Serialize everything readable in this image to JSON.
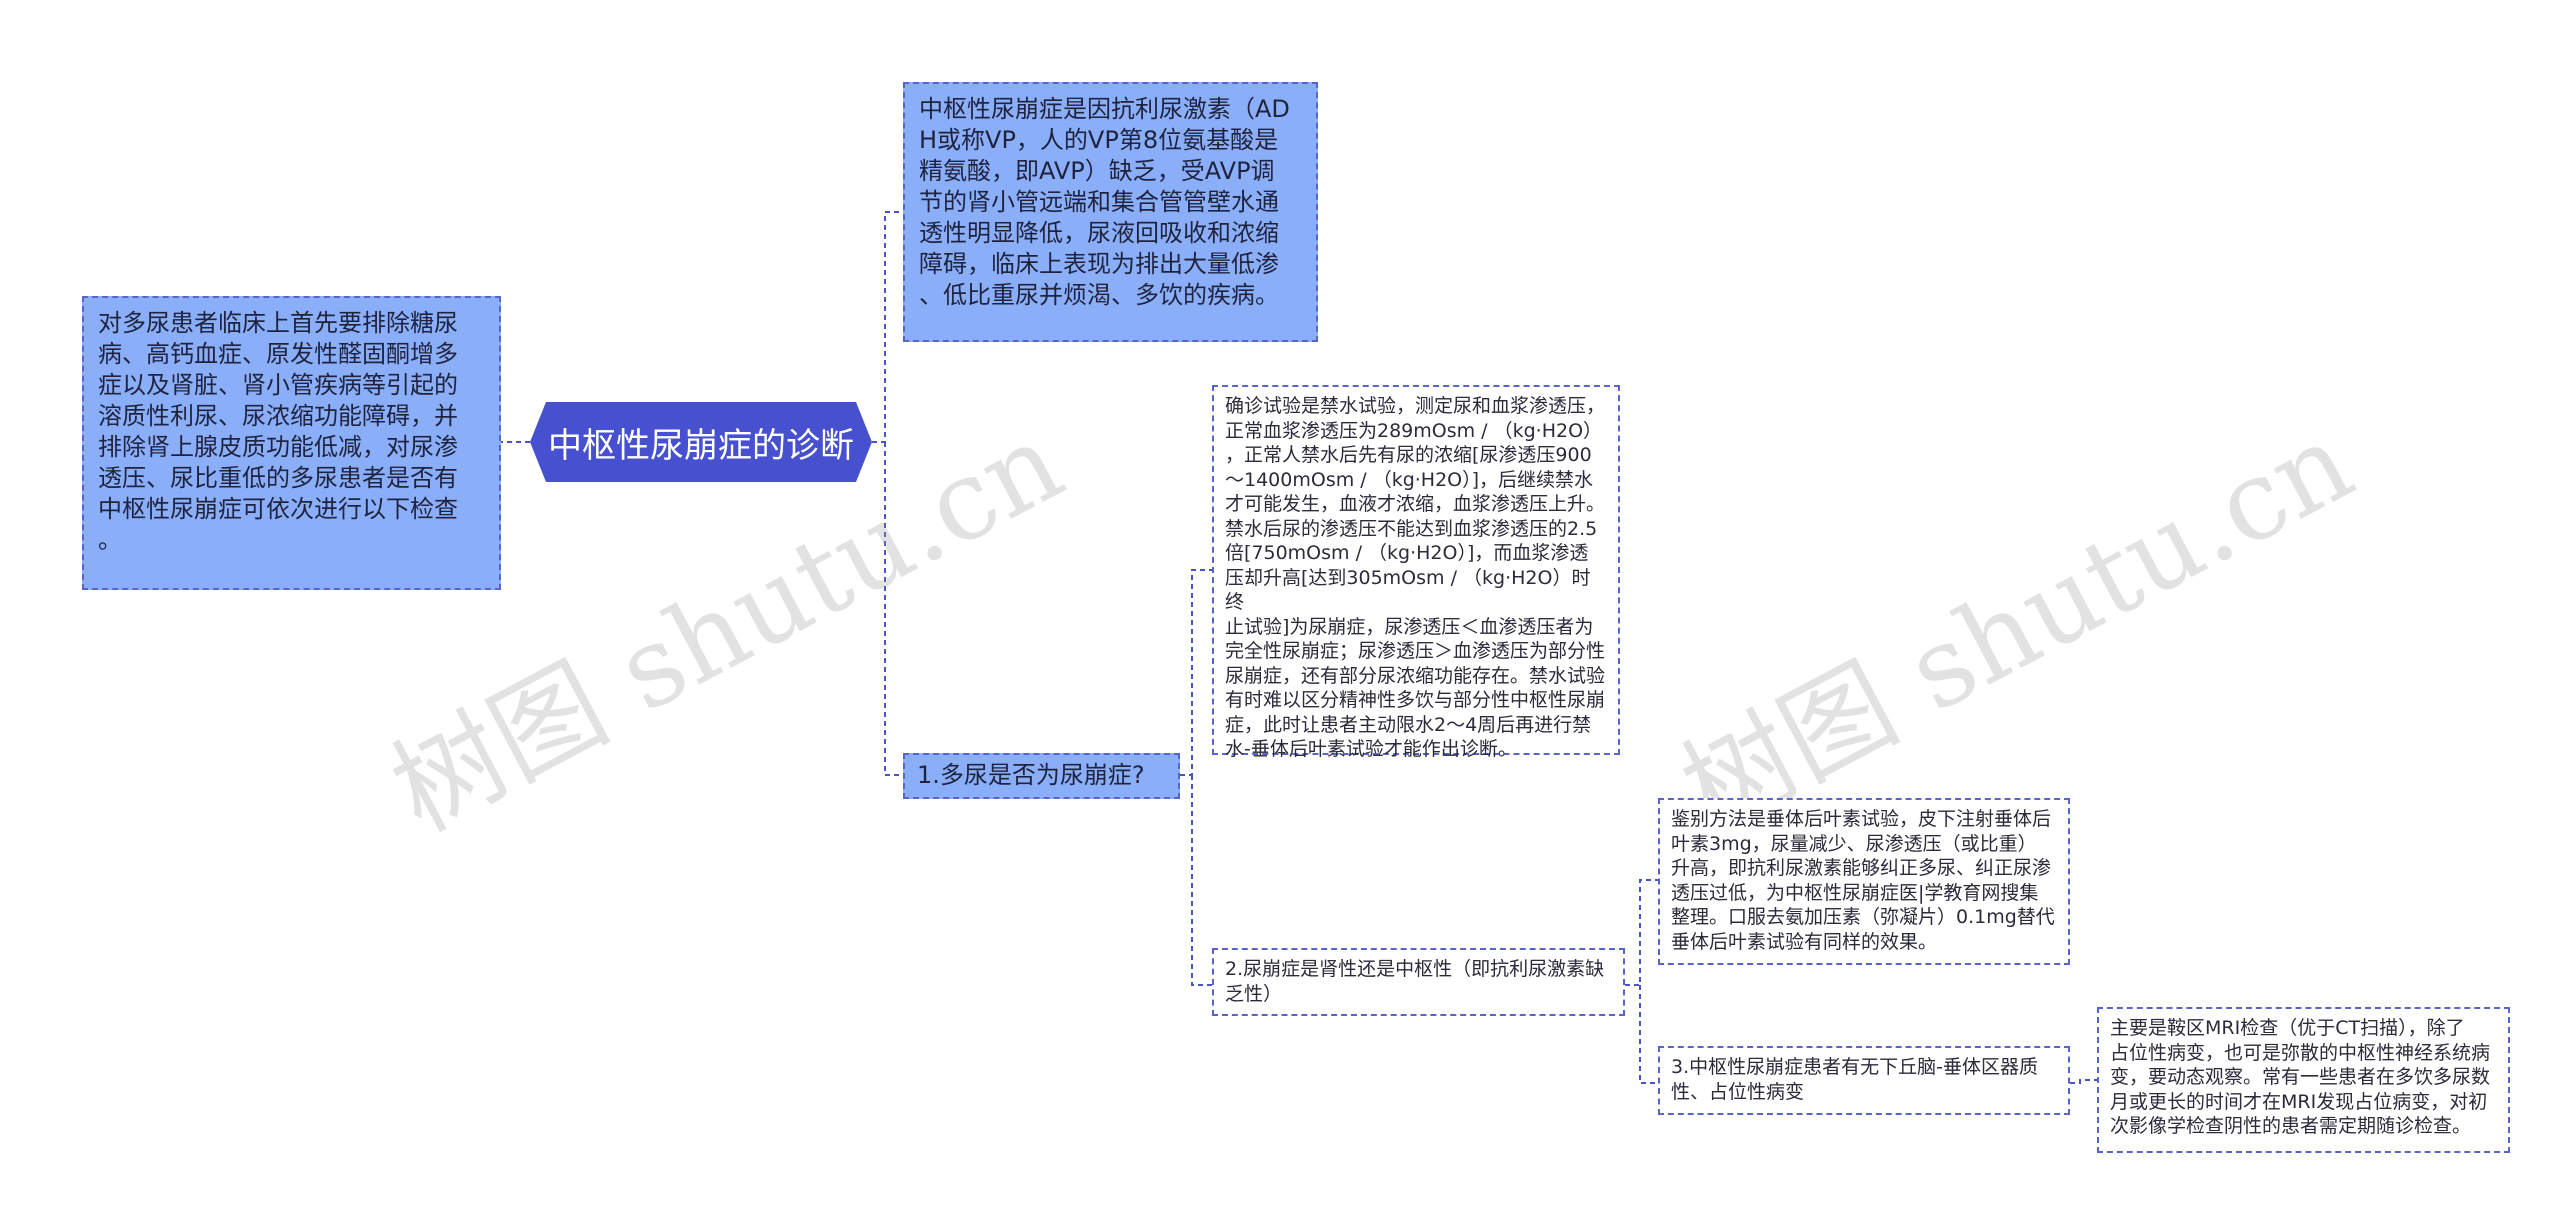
{
  "diagram": {
    "root": {
      "label": "中枢性尿崩症的诊断"
    },
    "left_note": {
      "text": "对多尿患者临床上首先要排除糖尿\n病、高钙血症、原发性醛固酮增多\n症以及肾脏、肾小管疾病等引起的\n溶质性利尿、尿浓缩功能障碍，并\n排除肾上腺皮质功能低减，对尿渗\n透压、尿比重低的多尿患者是否有\n中枢性尿崩症可依次进行以下检查\n。"
    },
    "definition": {
      "text": "中枢性尿崩症是因抗利尿激素（AD\nH或称VP，人的VP第8位氨基酸是\n精氨酸，即AVP）缺乏，受AVP调\n节的肾小管远端和集合管管壁水通\n透性明显降低，尿液回吸收和浓缩\n障碍，临床上表现为排出大量低渗\n、低比重尿并烦渴、多饮的疾病。"
    },
    "step1": {
      "label": "1.多尿是否为尿崩症?"
    },
    "step1_detail": {
      "text": "确诊试验是禁水试验，测定尿和血浆渗透压，\n正常血浆渗透压为289mOsm /  （kg·H2O）\n，正常人禁水后先有尿的浓缩[尿渗透压900\n～1400mOsm /  （kg·H2O）]，后继续禁水\n才可能发生，血液才浓缩，血浆渗透压上升。\n禁水后尿的渗透压不能达到血浆渗透压的2.5\n倍[750mOsm /  （kg·H2O）]，而血浆渗透\n压却升高[达到305mOsm /  （kg·H2O）时终\n止试验]为尿崩症，尿渗透压＜血渗透压者为\n完全性尿崩症；尿渗透压＞血渗透压为部分性\n尿崩症，还有部分尿浓缩功能存在。禁水试验\n有时难以区分精神性多饮与部分性中枢性尿崩\n症，此时让患者主动限水2～4周后再进行禁\n水-垂体后叶素试验才能作出诊断。"
    },
    "step2": {
      "label": "2.尿崩症是肾性还是中枢性（即抗利尿激素缺\n乏性）"
    },
    "step2_detail": {
      "text": "鉴别方法是垂体后叶素试验，皮下注射垂体后\n叶素3mg，尿量减少、尿渗透压（或比重）\n升高，即抗利尿激素能够纠正多尿、纠正尿渗\n透压过低，为中枢性尿崩症医|学教育网搜集\n整理。口服去氨加压素（弥凝片）0.1mg替代\n垂体后叶素试验有同样的效果。"
    },
    "step3": {
      "label": "3.中枢性尿崩症患者有无下丘脑-垂体区器质\n性、占位性病变"
    },
    "step3_detail": {
      "text": "主要是鞍区MRI检查（优于CT扫描），除了\n占位性病变，也可是弥散的中枢性神经系统病\n变，要动态观察。常有一些患者在多饮多尿数\n月或更长的时间才在MRI发现占位病变，对初\n次影像学检查阴性的患者需定期随诊检查。"
    }
  },
  "watermarks": [
    "树图 shutu.cn",
    "树图 shutu.cn"
  ],
  "colors": {
    "root_fill": "#4751d0",
    "blue_fill": "#8aaef7",
    "border": "#5a63c8",
    "connector": "#4a54c4"
  }
}
